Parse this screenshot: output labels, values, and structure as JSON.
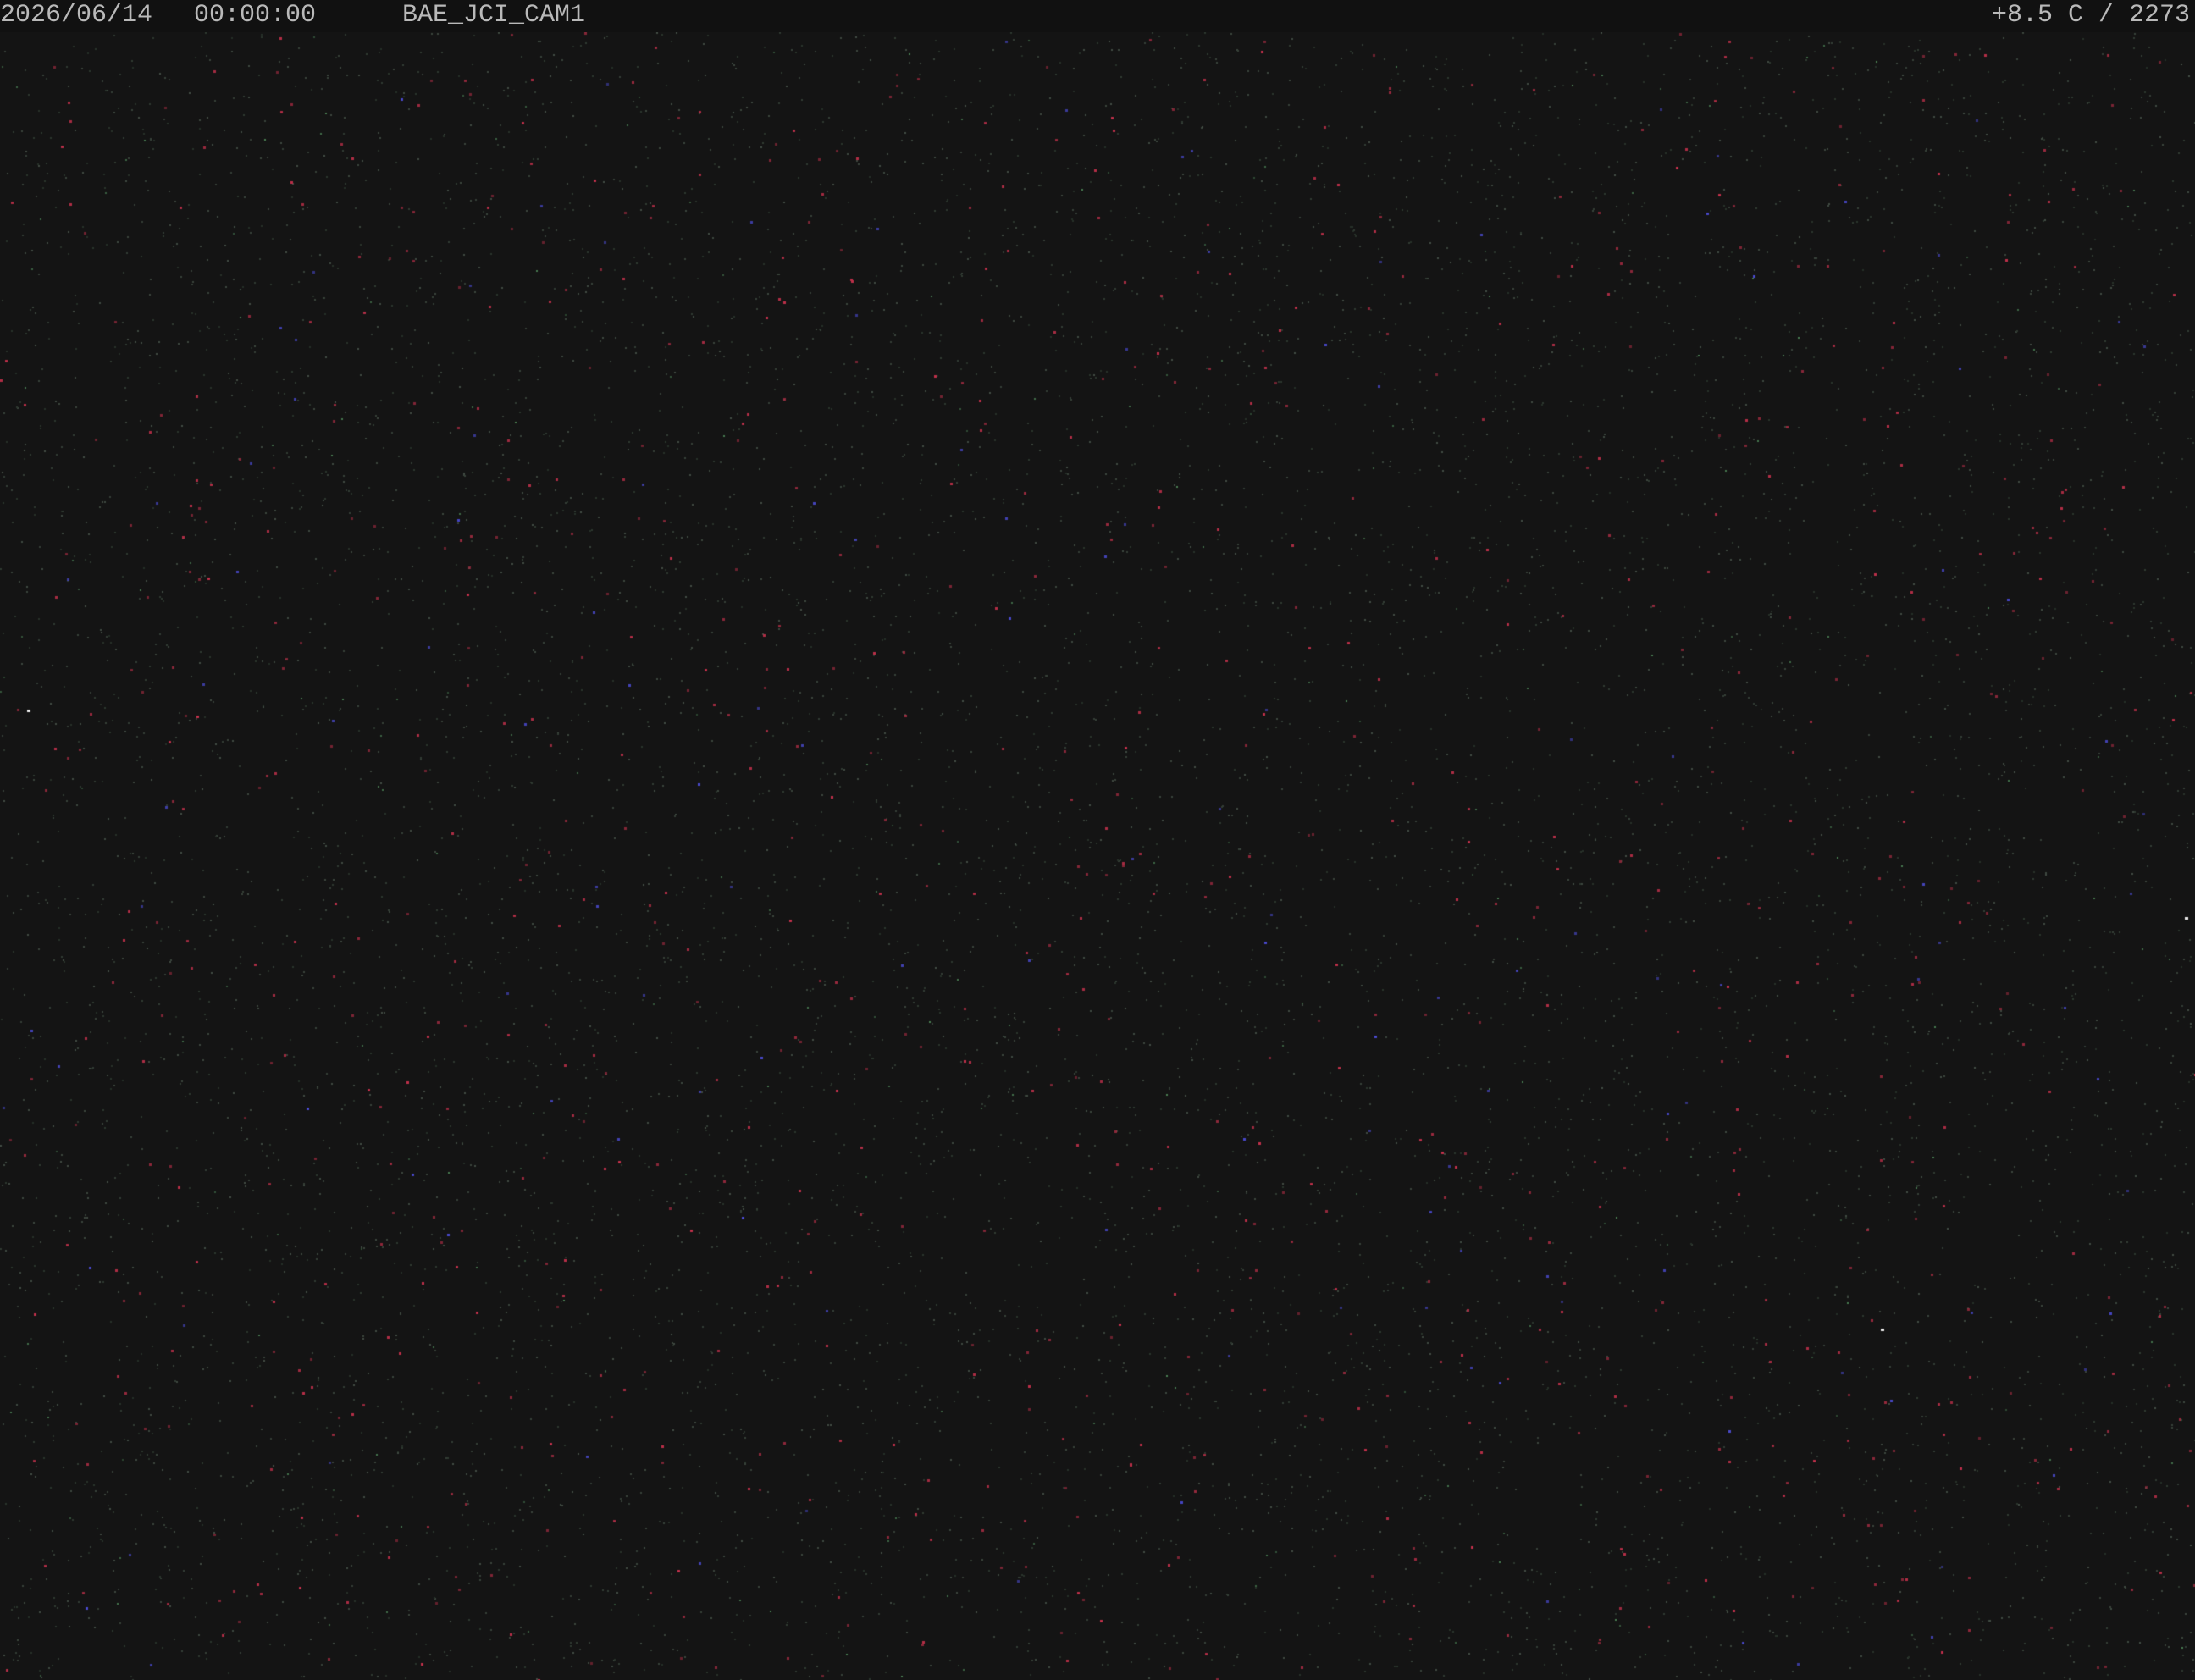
{
  "overlay": {
    "date": "2026/06/14",
    "time": "00:00:00",
    "camera_name": "BAE_JCI_CAM1",
    "temperature_readout": "+8.5 C / 2273"
  },
  "colors": {
    "sky_background": "#141414",
    "overlay_bar": "#111111",
    "overlay_text": "#b9b9b9",
    "hot_pixel_red": "#c0304a",
    "hot_pixel_blue": "#4a4ad0",
    "hot_pixel_green": "#4f8a5a",
    "hot_pixel_white": "#e8e8e8"
  }
}
